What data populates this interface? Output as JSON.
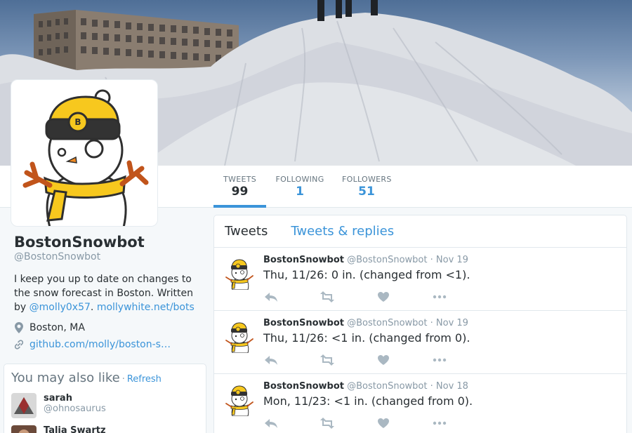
{
  "profile": {
    "name": "BostonSnowbot",
    "handle": "@BostonSnowbot",
    "bio_text_1": "I keep you up to date on changes to the snow forecast in Boston. Written by ",
    "bio_link_1": "@molly0x57",
    "bio_sep": ". ",
    "bio_link_2": "mollywhite.net/bots",
    "location": "Boston, MA",
    "website": "github.com/molly/boston-s…"
  },
  "stats": [
    {
      "label": "TWEETS",
      "value": "99"
    },
    {
      "label": "FOLLOWING",
      "value": "1"
    },
    {
      "label": "FOLLOWERS",
      "value": "51"
    }
  ],
  "tabs": [
    {
      "label": "Tweets"
    },
    {
      "label": "Tweets & replies"
    }
  ],
  "wtf": {
    "title": "You may also like",
    "dot": "·",
    "refresh": "Refresh",
    "users": [
      {
        "name": "sarah",
        "handle": "@ohnosaurus"
      },
      {
        "name": "Talia Swartz",
        "handle": ""
      }
    ]
  },
  "tweets": [
    {
      "name": "BostonSnowbot",
      "handle": "@BostonSnowbot",
      "sep": "·",
      "date": "Nov 19",
      "text": "Thu, 11/26: 0 in. (changed from <1)."
    },
    {
      "name": "BostonSnowbot",
      "handle": "@BostonSnowbot",
      "sep": "·",
      "date": "Nov 19",
      "text": "Thu, 11/26: <1 in. (changed from 0)."
    },
    {
      "name": "BostonSnowbot",
      "handle": "@BostonSnowbot",
      "sep": "·",
      "date": "Nov 18",
      "text": "Mon, 11/23: <1 in. (changed from 0)."
    }
  ],
  "colors": {
    "accent": "#3b94d9",
    "hat_yellow": "#f7c81e",
    "hat_black": "#333333"
  },
  "icons": {
    "location": "map-pin-icon",
    "website": "link-icon",
    "reply": "reply-icon",
    "retweet": "retweet-icon",
    "like": "heart-icon",
    "more": "more-icon"
  }
}
